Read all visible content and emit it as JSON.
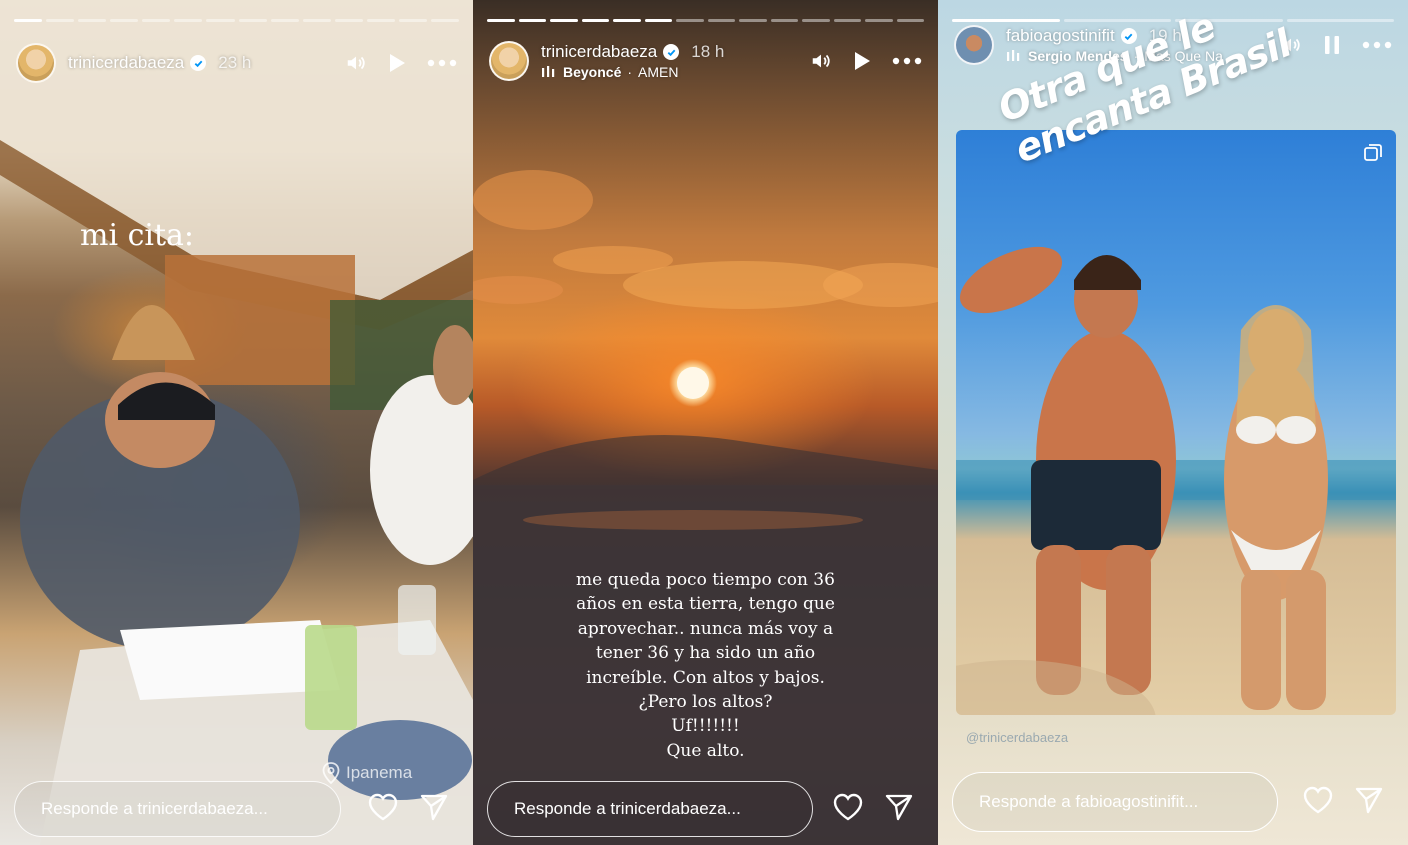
{
  "stories": [
    {
      "username": "trinicerdabaeza",
      "time": "23 h",
      "progress_segments": 14,
      "progress_done": 1,
      "overlay_text": "mi cita:",
      "location": "Ipanema",
      "reply_placeholder": "Responde a trinicerdabaeza..."
    },
    {
      "username": "trinicerdabaeza",
      "time": "18 h",
      "music_artist": "Beyoncé",
      "music_title": "AMEN",
      "progress_segments": 14,
      "progress_done": 6,
      "caption_lines": [
        "me queda poco tiempo con 36",
        "años en esta tierra, tengo que",
        "aprovechar.. nunca más voy a",
        "tener 36 y ha sido un año",
        "increíble. Con altos y bajos.",
        "¿Pero los altos?",
        "Uf!!!!!!!",
        "Que alto."
      ],
      "reply_placeholder": "Responde a trinicerdabaeza..."
    },
    {
      "username": "fabioagostinifit",
      "time": "19 h",
      "music_artist": "Sergio Mendes",
      "music_title": "Mas Que Na",
      "progress_segments": 4,
      "progress_done": 1,
      "sticker_text": "Otra que le encanta Brasil",
      "repost_handle": "@trinicerdabaeza",
      "reply_placeholder": "Responde a fabioagostinifit..."
    }
  ],
  "icons": {
    "verified": "verified-badge-icon",
    "sound": "speaker-icon",
    "play": "play-icon",
    "pause": "pause-icon",
    "more": "more-icon",
    "like": "heart-icon",
    "share": "send-icon",
    "music": "music-bars-icon",
    "location": "location-pin-icon"
  },
  "colors": {
    "verified_check": "#0095f6",
    "text": "#ffffff"
  }
}
